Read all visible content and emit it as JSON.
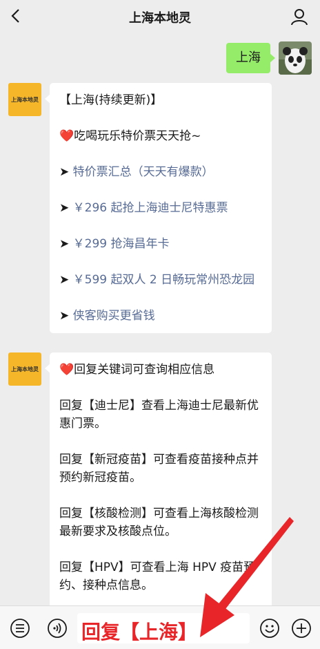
{
  "header": {
    "title": "上海本地灵"
  },
  "messages": {
    "user_message": "上海",
    "oa_avatar_label": "上海本地灵",
    "card1": {
      "heading": "【上海(持续更新)】",
      "intro_heart": "❤️",
      "intro": "吃喝玩乐特价票天天抢~",
      "arrow": "➤",
      "links": [
        "特价票汇总（天天有爆款）",
        "￥296 起抢上海迪士尼特惠票",
        "￥299 抢海昌年卡",
        "￥599 起双人 2 日畅玩常州恐龙园",
        "侠客购买更省钱"
      ]
    },
    "card2": {
      "heart": "❤️",
      "intro": "回复关键词可查询相应信息",
      "lines": [
        "回复【迪士尼】查看上海迪士尼最新优惠门票。",
        "回复【新冠疫苗】可查看疫苗接种点并预约新冠疫苗。",
        "回复【核酸检测】可查看上海核酸检测最新要求及核酸点位。",
        "回复【HPV】可查看上海 HPV 疫苗预约、接种点信息。"
      ]
    }
  },
  "input_bar": {
    "text": "回复【上海】"
  },
  "colors": {
    "accent_green": "#95ec69",
    "link_blue": "#576b95",
    "annotation_red": "#e8262a"
  }
}
